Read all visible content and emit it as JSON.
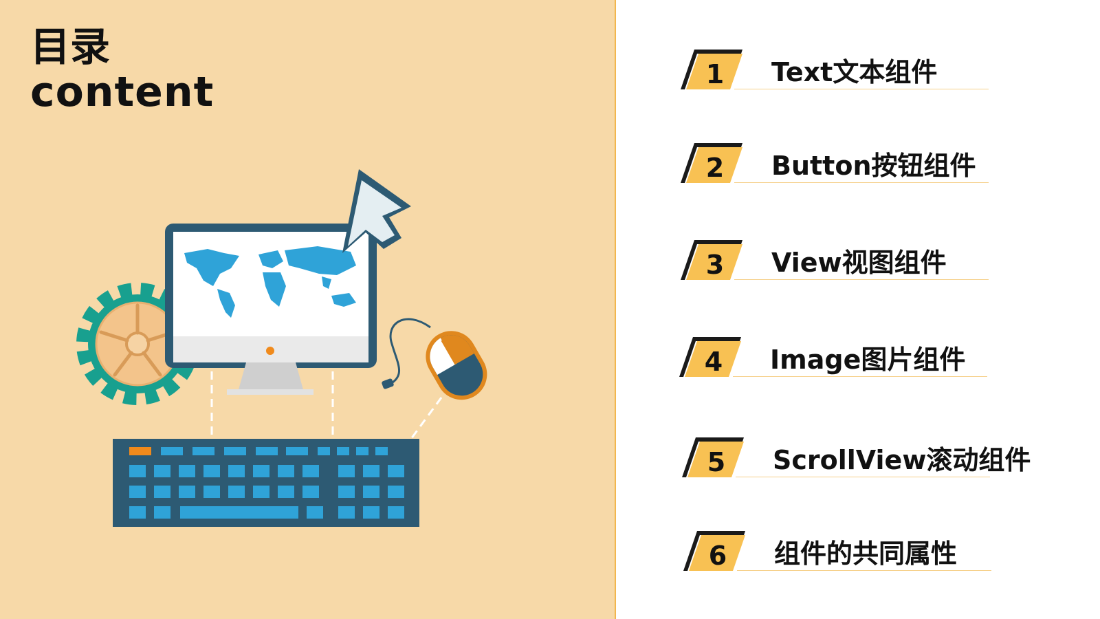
{
  "heading": {
    "cn": "目录",
    "en": "content"
  },
  "toc": [
    {
      "num": "1",
      "label": "Text文本组件"
    },
    {
      "num": "2",
      "label": "Button按钮组件"
    },
    {
      "num": "3",
      "label": "View视图组件"
    },
    {
      "num": "4",
      "label": "Image图片组件"
    },
    {
      "num": "5",
      "label": "ScrollView滚动组件"
    },
    {
      "num": "6",
      "label": "组件的共同属性"
    }
  ],
  "colors": {
    "panel_bg": "#f7d9a8",
    "accent": "#f8c153",
    "badge_dark": "#1a1a1a",
    "monitor": "#2d5a73",
    "map": "#2fa3d8",
    "gear": "#18a08f",
    "mouse_orange": "#e0881e"
  },
  "illustration": {
    "icons": [
      "gear-icon",
      "monitor-icon",
      "world-map-icon",
      "cursor-icon",
      "mouse-icon",
      "keyboard-icon"
    ]
  }
}
